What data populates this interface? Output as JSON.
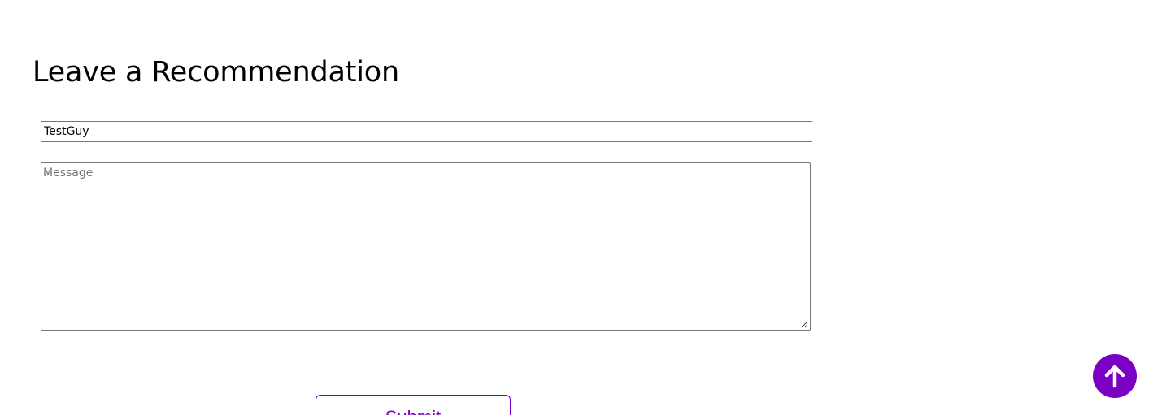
{
  "header": {
    "title": "Leave a Recommendation"
  },
  "form": {
    "name_value": "TestGuy",
    "message_placeholder": "Message",
    "message_value": "",
    "submit_label": "Submit"
  },
  "colors": {
    "accent": "#7b00c4",
    "input_border": "#767676",
    "placeholder": "#757575"
  },
  "icons": {
    "scroll_top": "arrow-up-icon",
    "resize": "resize-grip-icon"
  }
}
